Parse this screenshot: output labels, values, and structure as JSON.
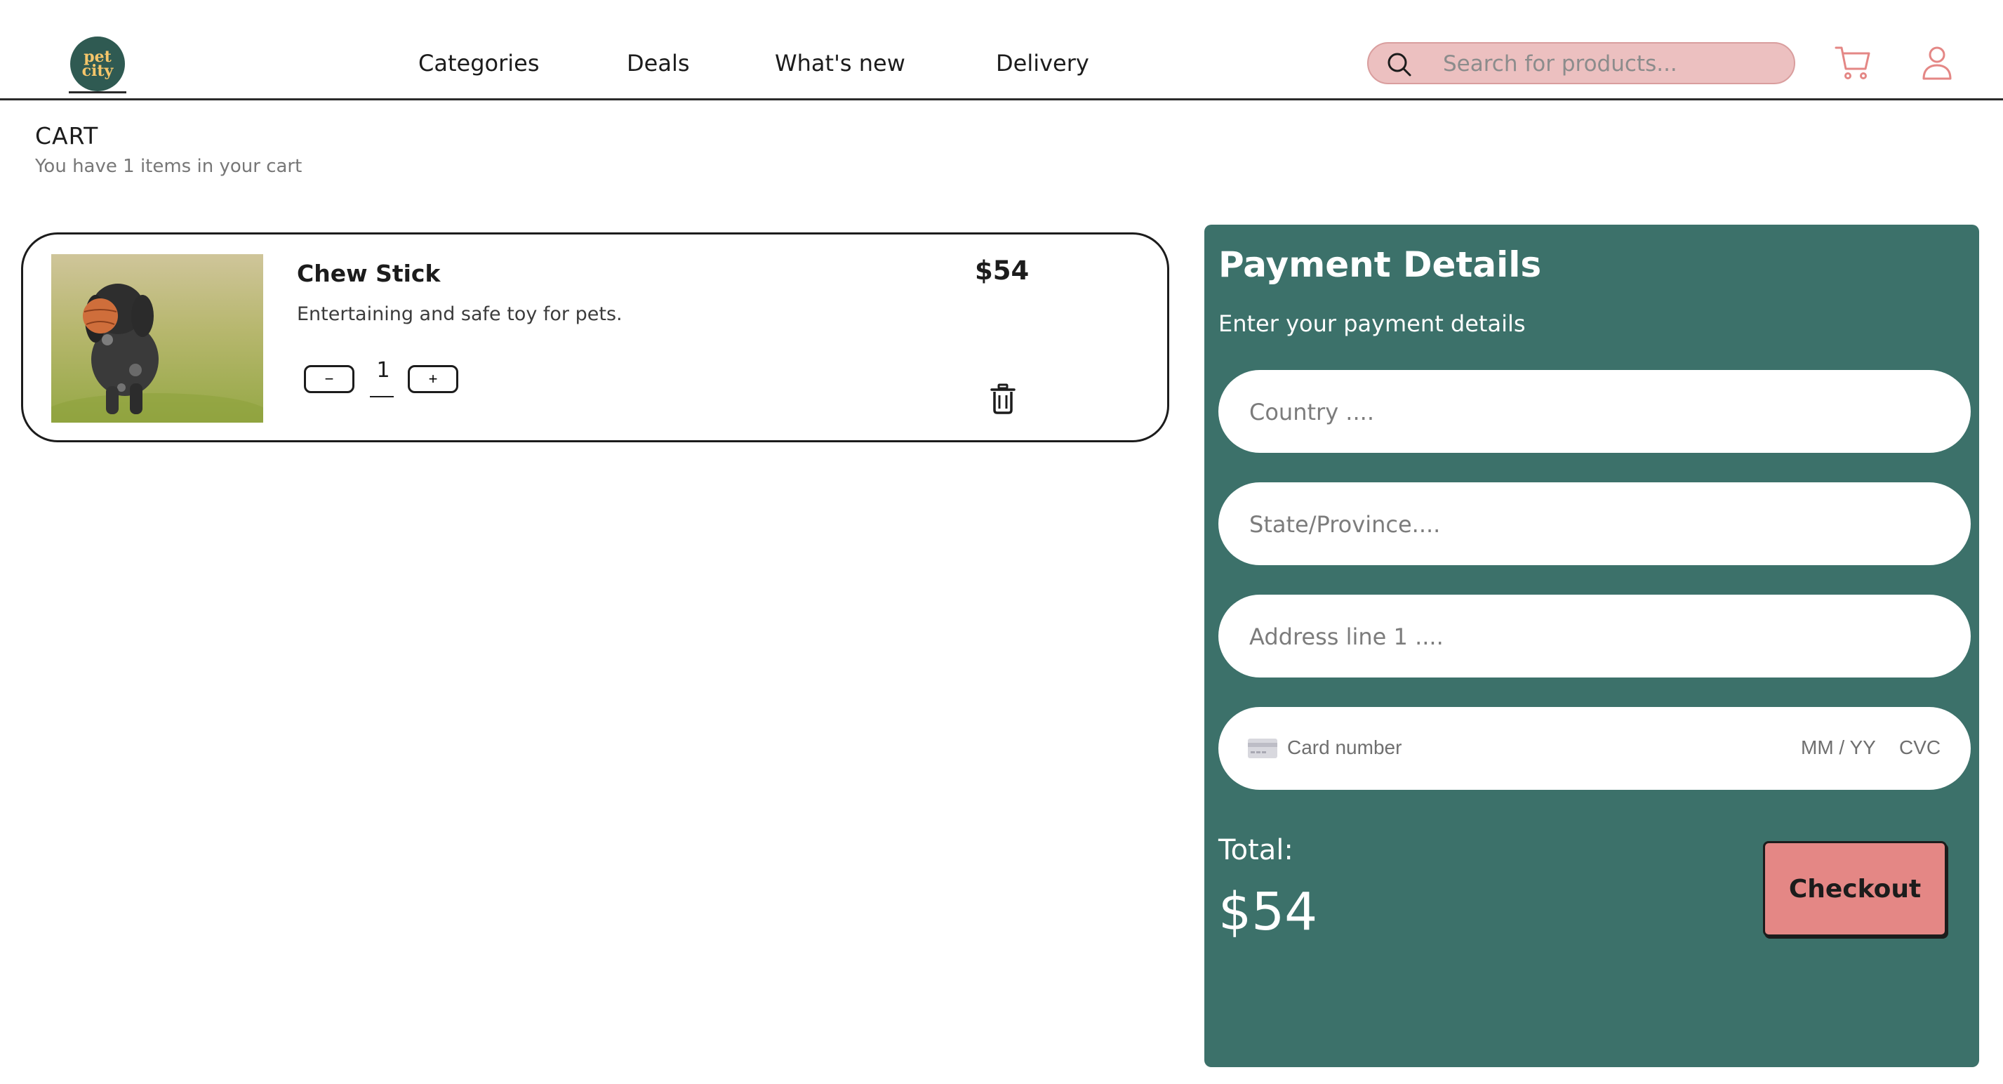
{
  "header": {
    "logo_text": "pet\ncity",
    "nav": [
      "Categories",
      "Deals",
      "What's new",
      "Delivery"
    ],
    "search_placeholder": "Search for products...",
    "accent_color": "#e48785"
  },
  "cart": {
    "title": "CART",
    "subtitle": "You have 1 items in your cart",
    "item": {
      "name": "Chew Stick",
      "description": "Entertaining and safe toy for pets.",
      "price": "$54",
      "quantity": "1",
      "decrement_label": "−",
      "increment_label": "+"
    }
  },
  "payment": {
    "title": "Payment Details",
    "subtitle": "Enter your payment details",
    "country_placeholder": "Country ....",
    "state_placeholder": "State/Province....",
    "address_placeholder": "Address line 1 ....",
    "card_placeholder": "Card number",
    "expiry_placeholder": "MM / YY",
    "cvc_placeholder": "CVC",
    "total_label": "Total:",
    "total_value": "$54",
    "checkout_label": "Checkout",
    "panel_color": "#3c716a"
  }
}
